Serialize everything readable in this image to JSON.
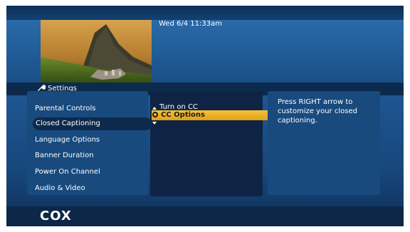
{
  "header": {
    "datetime": "Wed 6/4  11:33am"
  },
  "page": {
    "title": "Settings",
    "icon": "wrench-icon"
  },
  "menu": {
    "items": [
      {
        "label": "Parental Controls"
      },
      {
        "label": "Closed Captioning",
        "selected": true
      },
      {
        "label": "Language Options"
      },
      {
        "label": "Banner Duration"
      },
      {
        "label": "Power On Channel"
      },
      {
        "label": "Audio & Video"
      }
    ]
  },
  "submenu": {
    "items": [
      {
        "label": "Turn on CC"
      },
      {
        "label": "CC Options",
        "highlighted": true
      }
    ]
  },
  "help": {
    "text": "Press RIGHT arrow to customize your closed captioning."
  },
  "footer": {
    "logo": "COX"
  },
  "colors": {
    "highlight": "#f0b323",
    "background": "#1a4b82"
  }
}
